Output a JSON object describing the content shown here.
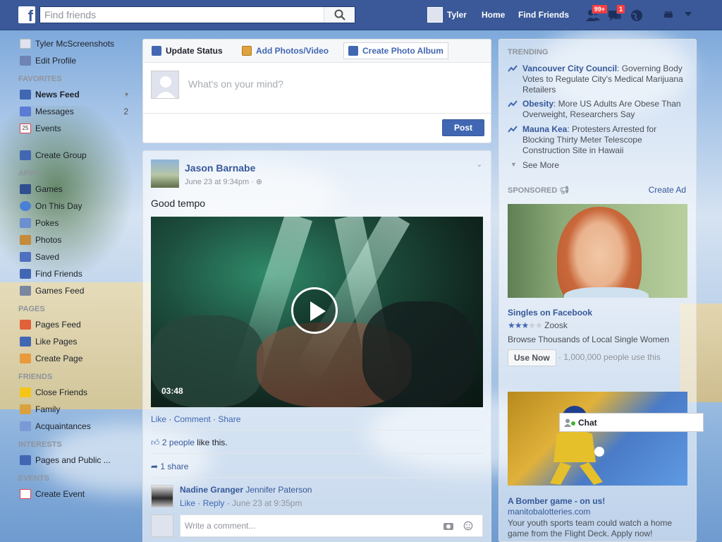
{
  "topbar": {
    "logo": "f",
    "search_placeholder": "Find friends",
    "user_name": "Tyler",
    "home_label": "Home",
    "find_friends_label": "Find Friends",
    "friend_requests_badge": "99+",
    "messages_badge": "1"
  },
  "sidebar": {
    "profile_name": "Tyler McScreenshots",
    "edit_profile": "Edit Profile",
    "favorites_header": "FAVORITES",
    "news_feed": "News Feed",
    "messages": "Messages",
    "messages_count": "2",
    "events": "Events",
    "events_date": "25",
    "create_group": "Create Group",
    "apps_header": "APPS",
    "apps": [
      "Games",
      "On This Day",
      "Pokes",
      "Photos",
      "Saved",
      "Find Friends",
      "Games Feed"
    ],
    "pages_header": "PAGES",
    "pages": [
      "Pages Feed",
      "Like Pages",
      "Create Page"
    ],
    "friends_header": "FRIENDS",
    "friends": [
      "Close Friends",
      "Family",
      "Acquaintances"
    ],
    "interests_header": "INTERESTS",
    "interests": [
      "Pages and Public ..."
    ],
    "events_header": "EVENTS",
    "create_event": "Create Event"
  },
  "composer": {
    "tab_update": "Update Status",
    "tab_photos": "Add Photos/Video",
    "tab_album": "Create Photo Album",
    "placeholder": "What's on your mind?",
    "post_button": "Post"
  },
  "post": {
    "author": "Jason Barnabe",
    "timestamp": "June 23 at 9:34pm",
    "text": "Good tempo",
    "video_duration": "03:48",
    "action_like": "Like",
    "action_comment": "Comment",
    "action_share": "Share",
    "likes_count": "2 people",
    "likes_suffix": "like this.",
    "shares": "1 share",
    "comment": {
      "names": "Nadine Granger",
      "names_tagged": "Jennifer Paterson",
      "like": "Like",
      "reply": "Reply",
      "time": "June 23 at 9:35pm"
    },
    "write_placeholder": "Write a comment..."
  },
  "right": {
    "trending_header": "TRENDING",
    "trends": [
      {
        "topic": "Vancouver City Council",
        "text": ": Governing Body Votes to Regulate City's Medical Marijuana Retailers"
      },
      {
        "topic": "Obesity",
        "text": ": More US Adults Are Obese Than Overweight, Researchers Say"
      },
      {
        "topic": "Mauna Kea",
        "text": ": Protesters Arrested for Blocking Thirty Meter Telescope Construction Site in Hawaii"
      }
    ],
    "see_more": "See More",
    "sponsored_header": "SPONSORED",
    "create_ad": "Create Ad",
    "ad1": {
      "title": "Singles on Facebook",
      "rating": 3,
      "advertiser": "Zoosk",
      "description": "Browse Thousands of Local Single Women",
      "cta": "Use Now",
      "users": "· 1,000,000 people use this"
    },
    "ad2": {
      "title": "A Bomber game - on us!",
      "domain": "manitobalotteries.com",
      "description": "Your youth sports team could watch a home game from the Flight Deck. Apply now!"
    }
  },
  "chat": {
    "label": "Chat"
  },
  "colors": {
    "brand": "#3b5998",
    "link": "#365899",
    "badge": "#fa3e3e",
    "online": "#42b72a"
  }
}
